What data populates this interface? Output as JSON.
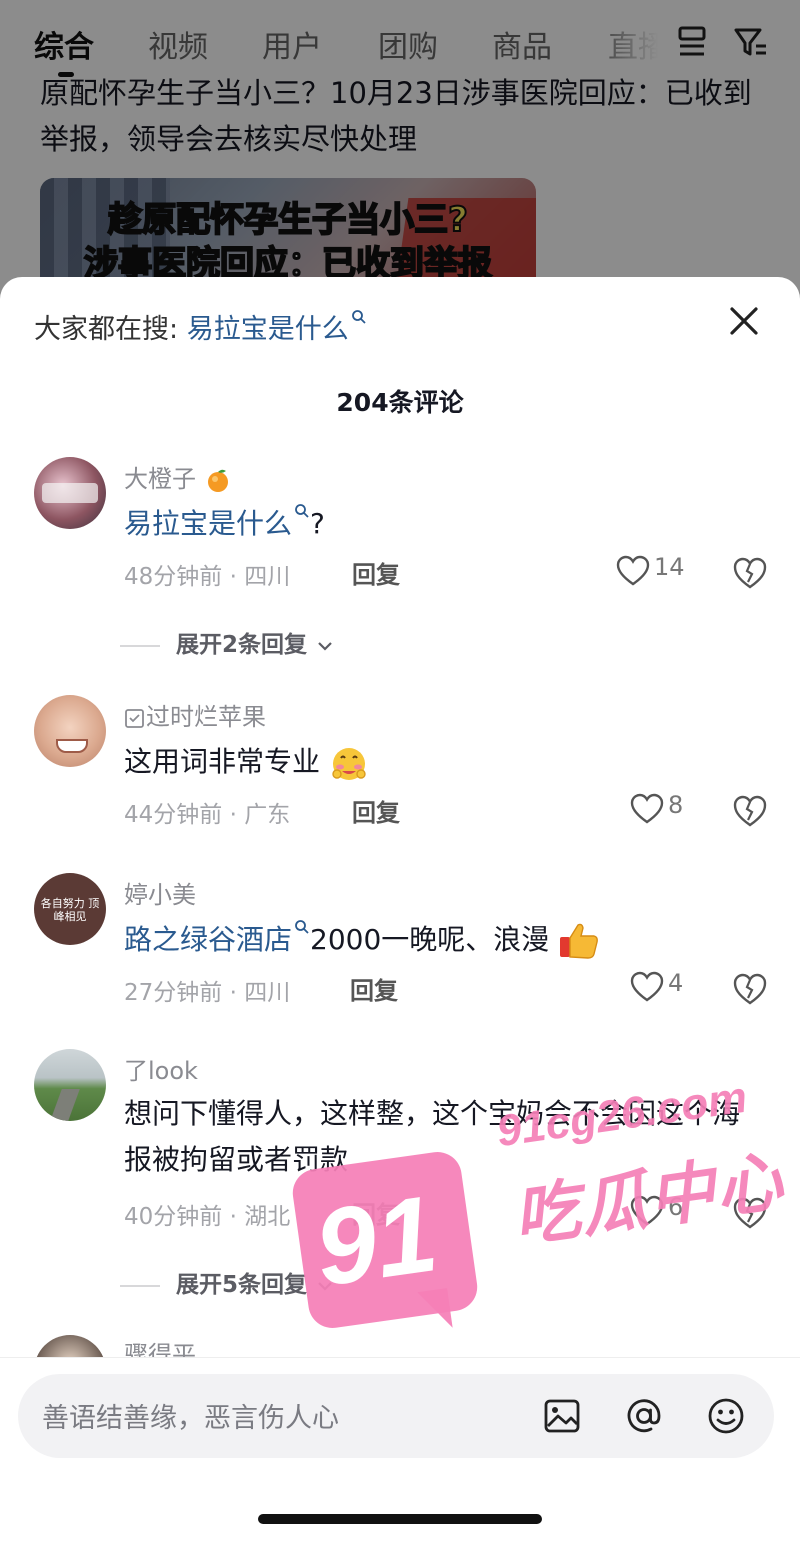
{
  "background": {
    "tabs": [
      "综合",
      "视频",
      "用户",
      "团购",
      "商品",
      "直播"
    ],
    "active_tab": 0,
    "result_title": "原配怀孕生子当小三？10月23日涉事医院回应：已收到举报，领导会去核实尽快处理",
    "thumb_lines": [
      "趁原配怀孕生子当小三?",
      "涉事医院回应：已收到举报"
    ]
  },
  "sheet": {
    "search_prefix": "大家都在搜:",
    "search_query": "易拉宝是什么",
    "comment_count": "204条评论"
  },
  "comments": [
    {
      "name": "大橙子",
      "link": "易拉宝是什么",
      "text": "?",
      "time": "48分钟前 · 四川",
      "reply": "回复",
      "likes": "14",
      "expand": "展开2条回复"
    },
    {
      "name": "过时烂苹果",
      "text": "这用词非常专业",
      "time": "44分钟前 · 广东",
      "reply": "回复",
      "likes": "8"
    },
    {
      "name": "婷小美",
      "link": "路之绿谷酒店",
      "text": "2000一晚呢、浪漫",
      "time": "27分钟前 · 四川",
      "reply": "回复",
      "likes": "4",
      "avatar_text": "各自努力 顶峰相见"
    },
    {
      "name": "了look",
      "text": "想问下懂得人，这样整，这个宝妈会不会因这个海报被拘留或者罚款",
      "time": "40分钟前 · 湖北",
      "reply": "回复",
      "likes": "6",
      "expand": "展开5条回复"
    },
    {
      "name": "骤得平"
    }
  ],
  "input": {
    "placeholder": "善语结善缘，恶言伤人心"
  },
  "watermark": {
    "number": "91",
    "url": "91cg26.com",
    "brand": "吃瓜中心"
  },
  "colors": {
    "link": "#2a5a8f",
    "watermark": "#f57fb7"
  }
}
